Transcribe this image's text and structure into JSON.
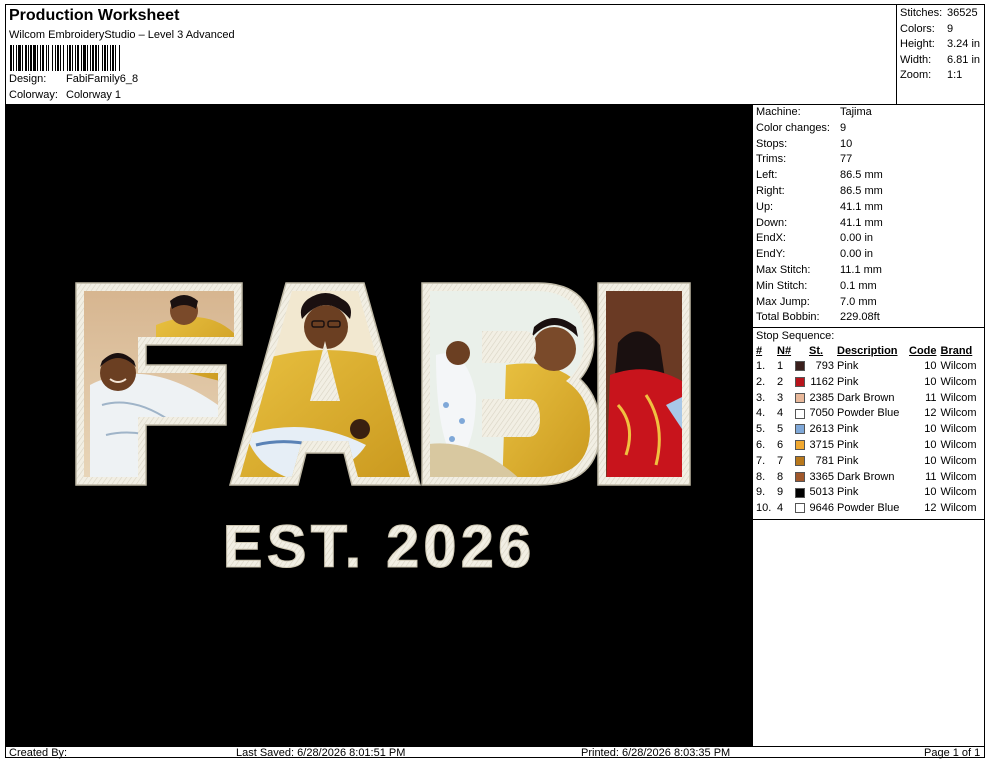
{
  "header": {
    "title": "Production Worksheet",
    "subtitle": "Wilcom EmbroideryStudio – Level 3 Advanced",
    "design_label": "Design:",
    "design_value": "FabiFamily6_8",
    "colorway_label": "Colorway:",
    "colorway_value": "Colorway 1"
  },
  "stats": [
    {
      "k": "Stitches:",
      "v": "36525"
    },
    {
      "k": "Colors:",
      "v": "9"
    },
    {
      "k": "Height:",
      "v": "3.24 in"
    },
    {
      "k": "Width:",
      "v": "6.81 in"
    },
    {
      "k": "Zoom:",
      "v": "1:1"
    }
  ],
  "design": {
    "letters": [
      "F",
      "A",
      "B",
      "I"
    ],
    "tagline": "EST. 2026"
  },
  "machine": [
    {
      "k": "Machine:",
      "v": "Tajima"
    },
    {
      "k": "Color changes:",
      "v": "9"
    },
    {
      "k": "Stops:",
      "v": "10"
    },
    {
      "k": "Trims:",
      "v": "77"
    },
    {
      "k": "Left:",
      "v": "86.5 mm"
    },
    {
      "k": "Right:",
      "v": "86.5 mm"
    },
    {
      "k": "Up:",
      "v": "41.1 mm"
    },
    {
      "k": "Down:",
      "v": "41.1 mm"
    },
    {
      "k": "EndX:",
      "v": "0.00 in"
    },
    {
      "k": "EndY:",
      "v": "0.00 in"
    },
    {
      "k": "Max Stitch:",
      "v": "11.1 mm"
    },
    {
      "k": "Min Stitch:",
      "v": "0.1 mm"
    },
    {
      "k": "Max Jump:",
      "v": "7.0 mm"
    },
    {
      "k": "Total Bobbin:",
      "v": "229.08ft"
    }
  ],
  "sequence": {
    "title": "Stop Sequence:",
    "headers": [
      "#",
      "N#",
      "St.",
      "Description",
      "Code",
      "Brand"
    ],
    "rows": [
      {
        "idx": "1.",
        "n": "1",
        "color": "#3a1f1c",
        "st": "793",
        "desc": "Pink",
        "code": "10",
        "brand": "Wilcom"
      },
      {
        "idx": "2.",
        "n": "2",
        "color": "#b8141c",
        "st": "1162",
        "desc": "Pink",
        "code": "10",
        "brand": "Wilcom"
      },
      {
        "idx": "3.",
        "n": "3",
        "color": "#e8b89a",
        "st": "2385",
        "desc": "Dark Brown",
        "code": "11",
        "brand": "Wilcom"
      },
      {
        "idx": "4.",
        "n": "4",
        "color": "#ffffff",
        "st": "7050",
        "desc": "Powder Blue",
        "code": "12",
        "brand": "Wilcom"
      },
      {
        "idx": "5.",
        "n": "5",
        "color": "#7fa8d8",
        "st": "2613",
        "desc": "Pink",
        "code": "10",
        "brand": "Wilcom"
      },
      {
        "idx": "6.",
        "n": "6",
        "color": "#f0a830",
        "st": "3715",
        "desc": "Pink",
        "code": "10",
        "brand": "Wilcom"
      },
      {
        "idx": "7.",
        "n": "7",
        "color": "#b8781c",
        "st": "781",
        "desc": "Pink",
        "code": "10",
        "brand": "Wilcom"
      },
      {
        "idx": "8.",
        "n": "8",
        "color": "#a0582c",
        "st": "3365",
        "desc": "Dark Brown",
        "code": "11",
        "brand": "Wilcom"
      },
      {
        "idx": "9.",
        "n": "9",
        "color": "#000000",
        "st": "5013",
        "desc": "Pink",
        "code": "10",
        "brand": "Wilcom"
      },
      {
        "idx": "10.",
        "n": "4",
        "color": "#ffffff",
        "st": "9646",
        "desc": "Powder Blue",
        "code": "12",
        "brand": "Wilcom"
      }
    ]
  },
  "footer": {
    "created": "Created By:",
    "saved": "Last Saved: 6/28/2026 8:01:51 PM",
    "printed": "Printed: 6/28/2026 8:03:35 PM",
    "page": "Page 1 of 1"
  }
}
